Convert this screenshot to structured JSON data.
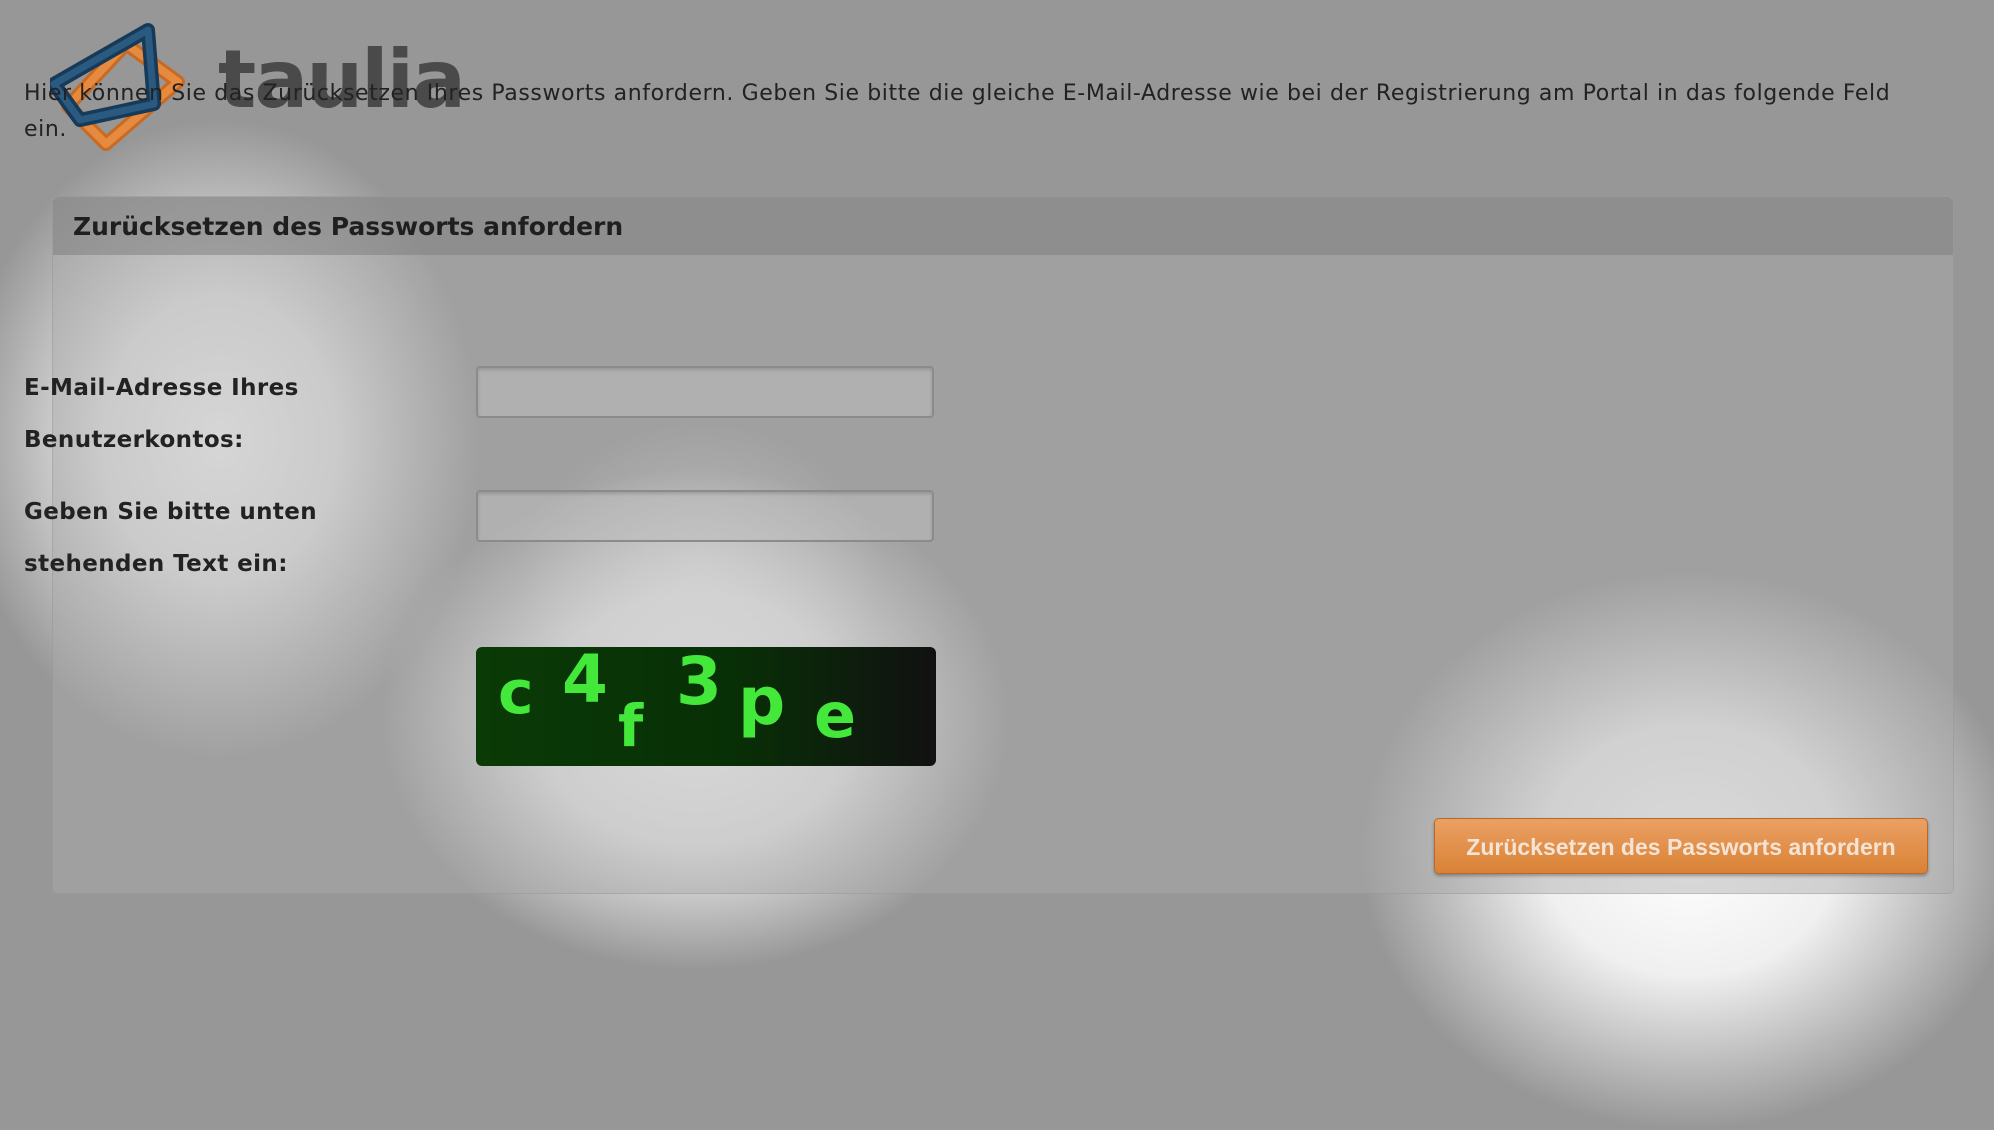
{
  "logo": {
    "text": "taulia",
    "colors": {
      "blue": "#1e4a6e",
      "orange": "#e07a2c",
      "text": "#4a4a4a"
    }
  },
  "panel": {
    "title": "Zurücksetzen des Passworts anfordern",
    "intro": "Hier können Sie das Zurücksetzen Ihres Passworts anfordern. Geben Sie bitte die gleiche E-Mail-Adresse wie bei der Registrierung am Portal in das folgende Feld ein."
  },
  "form": {
    "email_label": "E-Mail-Adresse Ihres Benutzerkontos:",
    "email_value": "",
    "captcha_label": "Geben Sie bitte unten stehenden Text ein:",
    "captcha_value": "",
    "captcha_chars": [
      "c",
      "4",
      "f",
      "3",
      "p",
      "e"
    ],
    "submit_label": "Zurücksetzen des Passworts anfordern"
  },
  "colors": {
    "accent": "#e08a3e",
    "captcha_text": "#43e83b",
    "captcha_bg": "#0a3a06"
  }
}
